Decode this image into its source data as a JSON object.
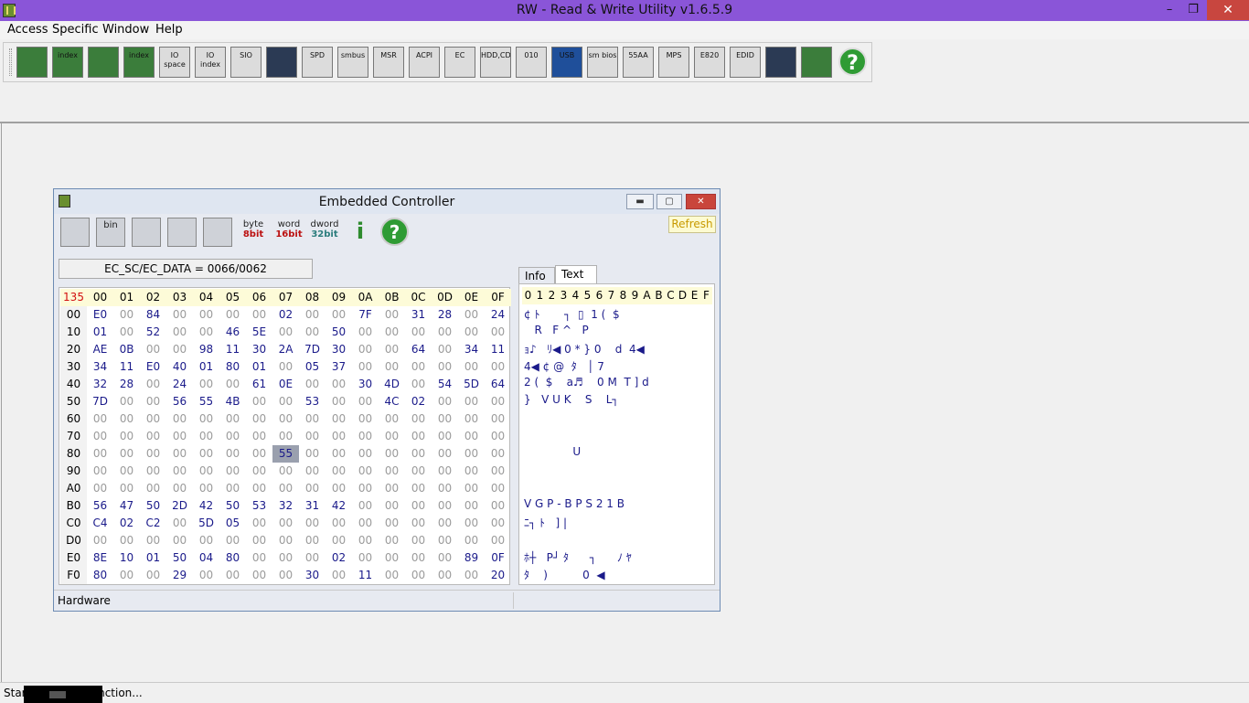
{
  "app": {
    "title": "RW - Read & Write Utility v1.6.5.9"
  },
  "window_controls": {
    "minimize": "–",
    "maximize": "❐",
    "close": "✕"
  },
  "menu": [
    "Access",
    "Specific",
    "Window",
    "Help"
  ],
  "toolbar": {
    "buttons": [
      {
        "name": "pci-icon",
        "label": ""
      },
      {
        "name": "pci-index-icon",
        "label": "index"
      },
      {
        "name": "memory-icon",
        "label": ""
      },
      {
        "name": "memory-index-icon",
        "label": "index"
      },
      {
        "name": "io-space-icon",
        "label": "IO space"
      },
      {
        "name": "io-index-icon",
        "label": "IO index"
      },
      {
        "name": "sio-icon",
        "label": "SIO"
      },
      {
        "name": "waveform-icon",
        "label": ""
      },
      {
        "name": "spd-icon",
        "label": "SPD"
      },
      {
        "name": "smbus-icon",
        "label": "smbus"
      },
      {
        "name": "msr-icon",
        "label": "MSR"
      },
      {
        "name": "acpi-icon",
        "label": "ACPI"
      },
      {
        "name": "ec-icon",
        "label": "EC"
      },
      {
        "name": "hdd-cd-icon",
        "label": "HDD,CD"
      },
      {
        "name": "disk-icon",
        "label": "010"
      },
      {
        "name": "usb-icon",
        "label": "USB"
      },
      {
        "name": "smbios-icon",
        "label": "sm bios"
      },
      {
        "name": "55aa-icon",
        "label": "55AA"
      },
      {
        "name": "mps-icon",
        "label": "MPS"
      },
      {
        "name": "e820-icon",
        "label": "E820"
      },
      {
        "name": "edid-icon",
        "label": "EDID"
      },
      {
        "name": "terminal-icon",
        "label": ""
      },
      {
        "name": "tools-icon",
        "label": ""
      },
      {
        "name": "help-icon",
        "label": "?"
      }
    ]
  },
  "ec_window": {
    "title": "Embedded Controller",
    "controls": {
      "minimize": "▬",
      "maximize": "▢",
      "close": "✕"
    },
    "refresh_label": "Refresh",
    "address_label": "EC_SC/EC_DATA = 0066/0062",
    "toolbar": {
      "byte": [
        "byte",
        "8bit"
      ],
      "word": [
        "word",
        "16bit"
      ],
      "dword": [
        "dword",
        "32bit"
      ],
      "bin": "bin",
      "info": "i",
      "help": "?"
    },
    "tabs": [
      "Info",
      "Text"
    ],
    "hex_corner": "135",
    "hex_columns": [
      "00",
      "01",
      "02",
      "03",
      "04",
      "05",
      "06",
      "07",
      "08",
      "09",
      "0A",
      "0B",
      "0C",
      "0D",
      "0E",
      "0F"
    ],
    "hex_rows": [
      {
        "addr": "00",
        "values": [
          "E0",
          "00",
          "84",
          "00",
          "00",
          "00",
          "00",
          "02",
          "00",
          "00",
          "7F",
          "00",
          "31",
          "28",
          "00",
          "24"
        ]
      },
      {
        "addr": "10",
        "values": [
          "01",
          "00",
          "52",
          "00",
          "00",
          "46",
          "5E",
          "00",
          "00",
          "50",
          "00",
          "00",
          "00",
          "00",
          "00",
          "00"
        ]
      },
      {
        "addr": "20",
        "values": [
          "AE",
          "0B",
          "00",
          "00",
          "98",
          "11",
          "30",
          "2A",
          "7D",
          "30",
          "00",
          "00",
          "64",
          "00",
          "34",
          "11"
        ]
      },
      {
        "addr": "30",
        "values": [
          "34",
          "11",
          "E0",
          "40",
          "01",
          "80",
          "01",
          "00",
          "05",
          "37",
          "00",
          "00",
          "00",
          "00",
          "00",
          "00"
        ]
      },
      {
        "addr": "40",
        "values": [
          "32",
          "28",
          "00",
          "24",
          "00",
          "00",
          "61",
          "0E",
          "00",
          "00",
          "30",
          "4D",
          "00",
          "54",
          "5D",
          "64"
        ]
      },
      {
        "addr": "50",
        "values": [
          "7D",
          "00",
          "00",
          "56",
          "55",
          "4B",
          "00",
          "00",
          "53",
          "00",
          "00",
          "4C",
          "02",
          "00",
          "00",
          "00"
        ]
      },
      {
        "addr": "60",
        "values": [
          "00",
          "00",
          "00",
          "00",
          "00",
          "00",
          "00",
          "00",
          "00",
          "00",
          "00",
          "00",
          "00",
          "00",
          "00",
          "00"
        ]
      },
      {
        "addr": "70",
        "values": [
          "00",
          "00",
          "00",
          "00",
          "00",
          "00",
          "00",
          "00",
          "00",
          "00",
          "00",
          "00",
          "00",
          "00",
          "00",
          "00"
        ]
      },
      {
        "addr": "80",
        "values": [
          "00",
          "00",
          "00",
          "00",
          "00",
          "00",
          "00",
          "55",
          "00",
          "00",
          "00",
          "00",
          "00",
          "00",
          "00",
          "00"
        ]
      },
      {
        "addr": "90",
        "values": [
          "00",
          "00",
          "00",
          "00",
          "00",
          "00",
          "00",
          "00",
          "00",
          "00",
          "00",
          "00",
          "00",
          "00",
          "00",
          "00"
        ]
      },
      {
        "addr": "A0",
        "values": [
          "00",
          "00",
          "00",
          "00",
          "00",
          "00",
          "00",
          "00",
          "00",
          "00",
          "00",
          "00",
          "00",
          "00",
          "00",
          "00"
        ]
      },
      {
        "addr": "B0",
        "values": [
          "56",
          "47",
          "50",
          "2D",
          "42",
          "50",
          "53",
          "32",
          "31",
          "42",
          "00",
          "00",
          "00",
          "00",
          "00",
          "00"
        ]
      },
      {
        "addr": "C0",
        "values": [
          "C4",
          "02",
          "C2",
          "00",
          "5D",
          "05",
          "00",
          "00",
          "00",
          "00",
          "00",
          "00",
          "00",
          "00",
          "00",
          "00"
        ]
      },
      {
        "addr": "D0",
        "values": [
          "00",
          "00",
          "00",
          "00",
          "00",
          "00",
          "00",
          "00",
          "00",
          "00",
          "00",
          "00",
          "00",
          "00",
          "00",
          "00"
        ]
      },
      {
        "addr": "E0",
        "values": [
          "8E",
          "10",
          "01",
          "50",
          "04",
          "80",
          "00",
          "00",
          "00",
          "02",
          "00",
          "00",
          "00",
          "00",
          "89",
          "0F"
        ]
      },
      {
        "addr": "F0",
        "values": [
          "80",
          "00",
          "00",
          "29",
          "00",
          "00",
          "00",
          "00",
          "30",
          "00",
          "11",
          "00",
          "00",
          "00",
          "00",
          "20"
        ]
      }
    ],
    "selected_cell": {
      "row": "80",
      "col": "07"
    },
    "text_header": [
      "0",
      "1",
      "2",
      "3",
      "4",
      "5",
      "6",
      "7",
      "8",
      "9",
      "A",
      "B",
      "C",
      "D",
      "E",
      "F"
    ],
    "text_rows": [
      "¢ ﾄ       ┐  ▯  1 (  $",
      "   R   F ^   P",
      "ｮ♪   ﾘ◀ 0 * } 0    d  4◀",
      "4◀ ¢ @  ﾀ   │ 7",
      "2 (  $    a♬    0 M  T ] d",
      "}   V U K    S    L┐",
      "",
      "",
      "              U",
      "",
      "",
      "V G P - B P S 2 1 B",
      "ﾆ┐ ﾄ   ] |",
      "",
      "ﾎ┼   P┘ ﾀ      ┐      ﾉ ﾔ",
      "ﾀ    )          0  ◀"
    ],
    "status": "Hardware"
  },
  "statusbar": {
    "text": "Star                    Controller function..."
  }
}
